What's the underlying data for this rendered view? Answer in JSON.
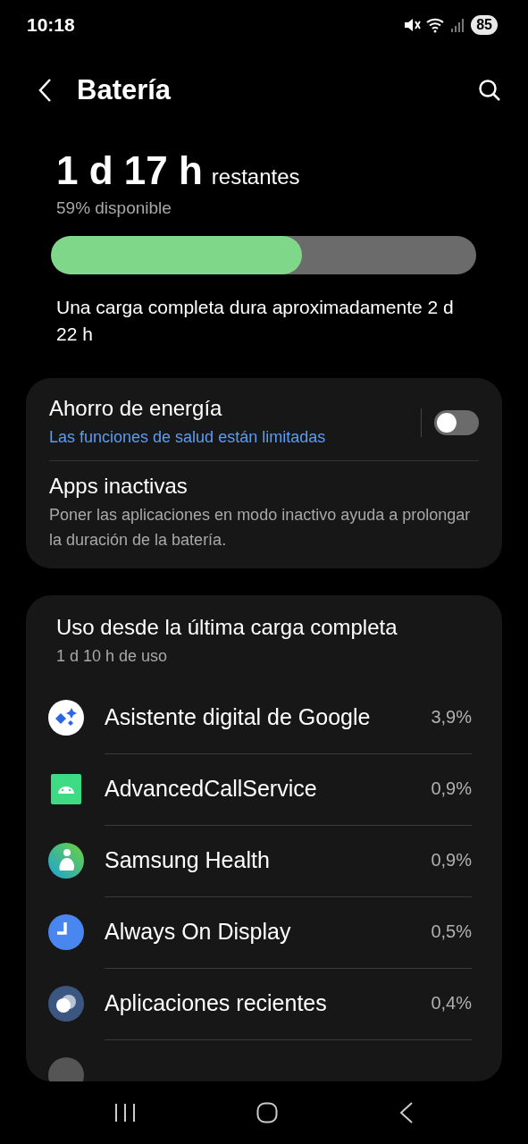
{
  "status_bar": {
    "time": "10:18",
    "battery": "85"
  },
  "header": {
    "title": "Batería"
  },
  "summary": {
    "remaining": "1 d 17 h",
    "remaining_label": "restantes",
    "available": "59% disponible",
    "level": 0.59,
    "full_charge": "Una carga completa dura aproximadamente 2 d 22 h"
  },
  "settings": [
    {
      "kind": "toggle",
      "title": "Ahorro de energía",
      "subtitle": "Las funciones de salud están limitadas",
      "on": false
    },
    {
      "kind": "link",
      "title": "Apps inactivas",
      "subtitle": "Poner las aplicaciones en modo inactivo ayuda a prolongar la duración de la batería."
    }
  ],
  "usage": {
    "title": "Uso desde la última carga completa",
    "subtitle": "1 d 10 h de uso",
    "apps": [
      {
        "kind": "assistant",
        "name": "Asistente digital de Google",
        "percent": "3,9%"
      },
      {
        "kind": "android",
        "name": "AdvancedCallService",
        "percent": "0,9%"
      },
      {
        "kind": "health",
        "name": "Samsung Health",
        "percent": "0,9%"
      },
      {
        "kind": "clock",
        "name": "Always On Display",
        "percent": "0,5%"
      },
      {
        "kind": "recent",
        "name": "Aplicaciones recientes",
        "percent": "0,4%"
      },
      {
        "kind": "partial"
      }
    ]
  }
}
